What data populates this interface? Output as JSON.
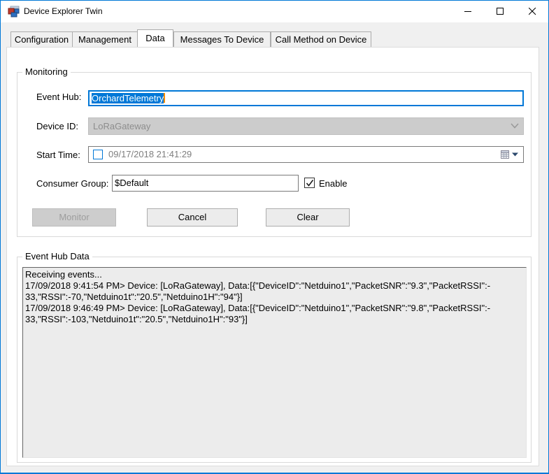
{
  "window": {
    "title": "Device Explorer Twin",
    "caption_buttons": [
      "minimize",
      "maximize",
      "close"
    ]
  },
  "tabs": [
    {
      "label": "Configuration",
      "selected": false
    },
    {
      "label": "Management",
      "selected": false
    },
    {
      "label": "Data",
      "selected": true
    },
    {
      "label": "Messages To Device",
      "selected": false
    },
    {
      "label": "Call Method on Device",
      "selected": false
    }
  ],
  "monitoring": {
    "legend": "Monitoring",
    "event_hub": {
      "label": "Event Hub:",
      "value": "OrchardTelemetry",
      "focused": true,
      "text_selected": true
    },
    "device_id": {
      "label": "Device ID:",
      "value": "LoRaGateway",
      "disabled": true
    },
    "start_time": {
      "label": "Start Time:",
      "value": "09/17/2018 21:41:29",
      "checked": false
    },
    "consumer_group": {
      "label": "Consumer Group:",
      "value": "$Default"
    },
    "enable": {
      "label": "Enable",
      "checked": true
    },
    "buttons": {
      "monitor": {
        "label": "Monitor",
        "disabled": true
      },
      "cancel": {
        "label": "Cancel",
        "disabled": false
      },
      "clear": {
        "label": "Clear",
        "disabled": false
      }
    }
  },
  "event_hub_data": {
    "legend": "Event Hub Data",
    "lines": [
      "Receiving events...",
      "17/09/2018 9:41:54 PM> Device: [LoRaGateway], Data:[{\"DeviceID\":\"Netduino1\",\"PacketSNR\":\"9.3\",\"PacketRSSI\":-",
      "33,\"RSSI\":-70,\"Netduino1t\":\"20.5\",\"Netduino1H\":\"94\"}]",
      "17/09/2018 9:46:49 PM> Device: [LoRaGateway], Data:[{\"DeviceID\":\"Netduino1\",\"PacketSNR\":\"9.8\",\"PacketRSSI\":-",
      "33,\"RSSI\":-103,\"Netduino1t\":\"20.5\",\"Netduino1H\":\"93\"}]"
    ]
  },
  "icons": {
    "app_icon": "winforms-app-icon",
    "combo_arrow": "chevron-down-icon",
    "dtp_calendar": "calendar-icon",
    "dtp_arrow": "dropdown-arrow-icon",
    "enable_check": "checkmark-icon"
  },
  "colors": {
    "accent": "#0078d7",
    "selection": "#0078d7",
    "disabled_bg": "#cccccc",
    "disabled_text": "#9d9d9d",
    "muted_text": "#7f7f7f",
    "log_bg": "#ececec"
  }
}
